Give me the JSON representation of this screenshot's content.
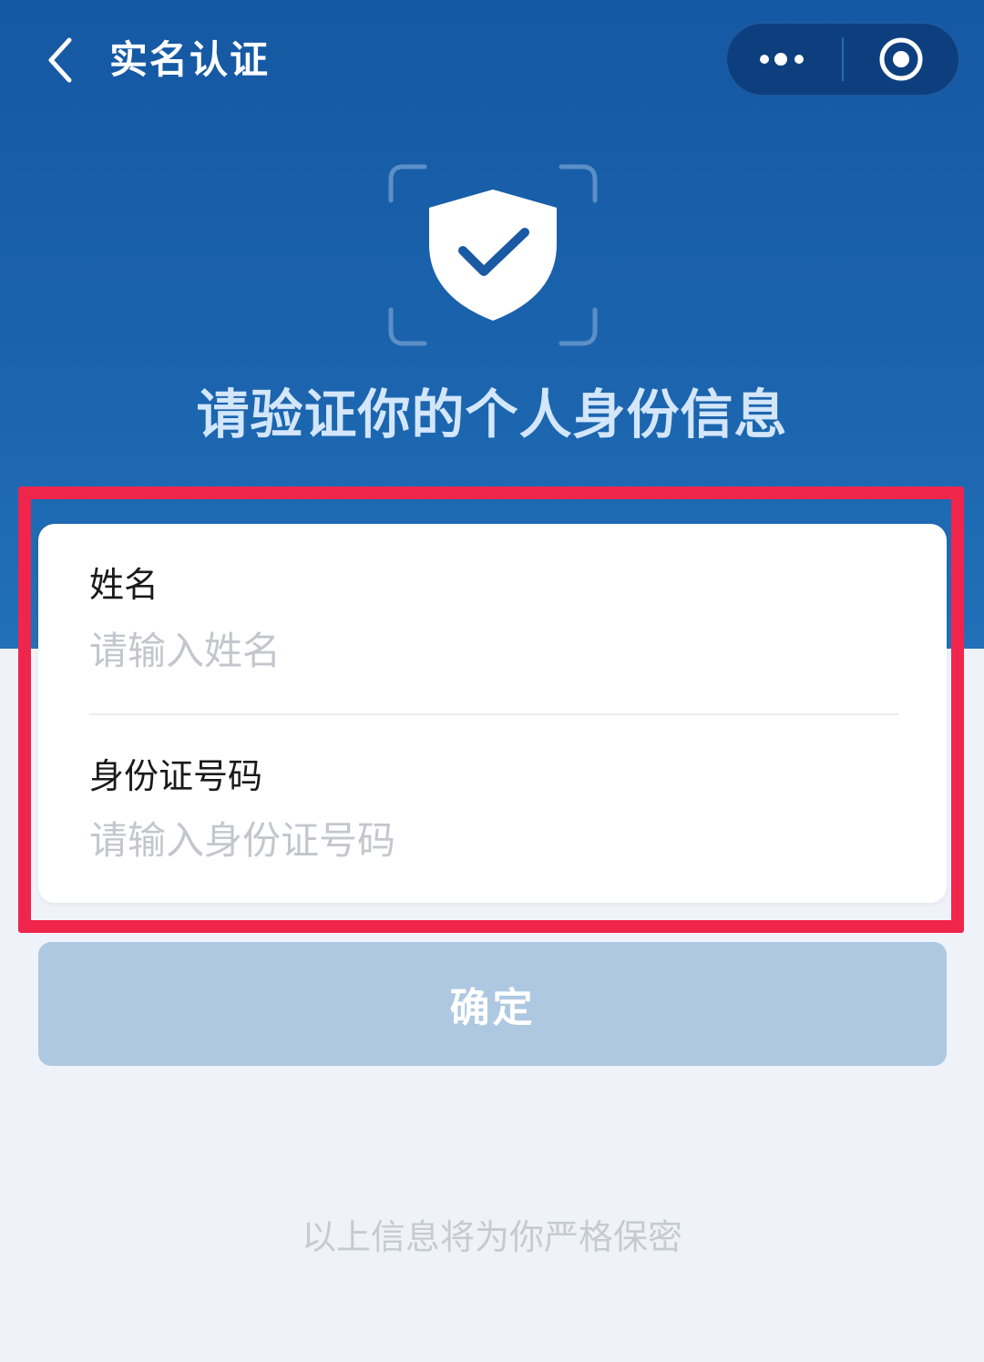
{
  "nav": {
    "title": "实名认证",
    "back_icon": "chevron-left-icon",
    "more_icon": "more-dots-icon",
    "close_icon": "target-circle-icon"
  },
  "hero": {
    "emblem_icon": "shield-check-icon",
    "headline": "请验证你的个人身份信息"
  },
  "form": {
    "name": {
      "label": "姓名",
      "placeholder": "请输入姓名",
      "value": ""
    },
    "id_number": {
      "label": "身份证号码",
      "placeholder": "请输入身份证号码",
      "value": ""
    }
  },
  "confirm_label": "确定",
  "privacy_note": "以上信息将为你严格保密",
  "colors": {
    "header_blue": "#1558a3",
    "page_bg": "#eff3f9",
    "button_disabled": "#aec8e1",
    "highlight_red": "#f0254c"
  }
}
